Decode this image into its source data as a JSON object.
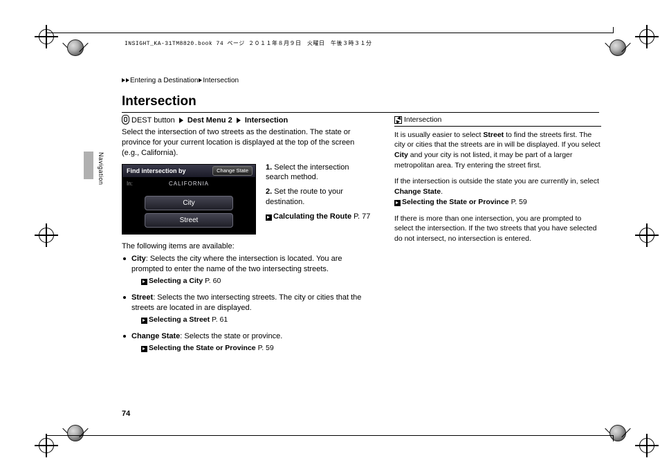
{
  "header_line": "INSIGHT_KA-31TM8820.book  74 ページ  ２０１１年８月９日　火曜日　午後３時３１分",
  "breadcrumb": {
    "level1": "Entering a Destination",
    "level2": "Intersection"
  },
  "section_tab": "Navigation",
  "title": "Intersection",
  "nav": {
    "btn": "DEST button",
    "menu": "Dest Menu 2",
    "item": "Intersection"
  },
  "intro": "Select the intersection of two streets as the destination. The state or province for your current location is displayed at the top of the screen (e.g., California).",
  "screenshot": {
    "title": "Find intersection by",
    "change_state": "Change State",
    "in_label": "In:",
    "in_value": "CALIFORNIA",
    "btn_city": "City",
    "btn_street": "Street"
  },
  "steps": {
    "s1_num": "1.",
    "s1_text": "Select the intersection search method.",
    "s2_num": "2.",
    "s2_text": "Set the route to your destination.",
    "s2_ref_label": "Calculating the Route",
    "s2_ref_page": "P. 77"
  },
  "avail_intro": "The following items are available:",
  "items": {
    "city": {
      "name": "City",
      "desc": ": Selects the city where the intersection is located. You are prompted to enter the name of the two intersecting streets.",
      "ref_label": "Selecting a City",
      "ref_page": "P. 60"
    },
    "street": {
      "name": "Street",
      "desc": ": Selects the two intersecting streets. The city or cities that the streets are located in are displayed.",
      "ref_label": "Selecting a Street",
      "ref_page": "P. 61"
    },
    "change_state": {
      "name": "Change State",
      "desc": ": Selects the state or province.",
      "ref_label": "Selecting the State or Province",
      "ref_page": "P. 59"
    }
  },
  "sidebar": {
    "title": "Intersection",
    "p1a": "It is usually easier to select ",
    "p1b": "Street",
    "p1c": " to find the streets first. The city or cities that the streets are in will be displayed. If you select ",
    "p1d": "City",
    "p1e": " and your city is not listed, it may be part of a larger metropolitan area. Try entering the street first.",
    "p2a": "If the intersection is outside the state you are currently in, select ",
    "p2b": "Change State",
    "p2c": ".",
    "p2_ref_label": "Selecting the State or Province",
    "p2_ref_page": "P. 59",
    "p3": "If there is more than one intersection, you are prompted to select the intersection. If the two streets that you have selected do not intersect, no intersection is entered."
  },
  "page_number": "74"
}
